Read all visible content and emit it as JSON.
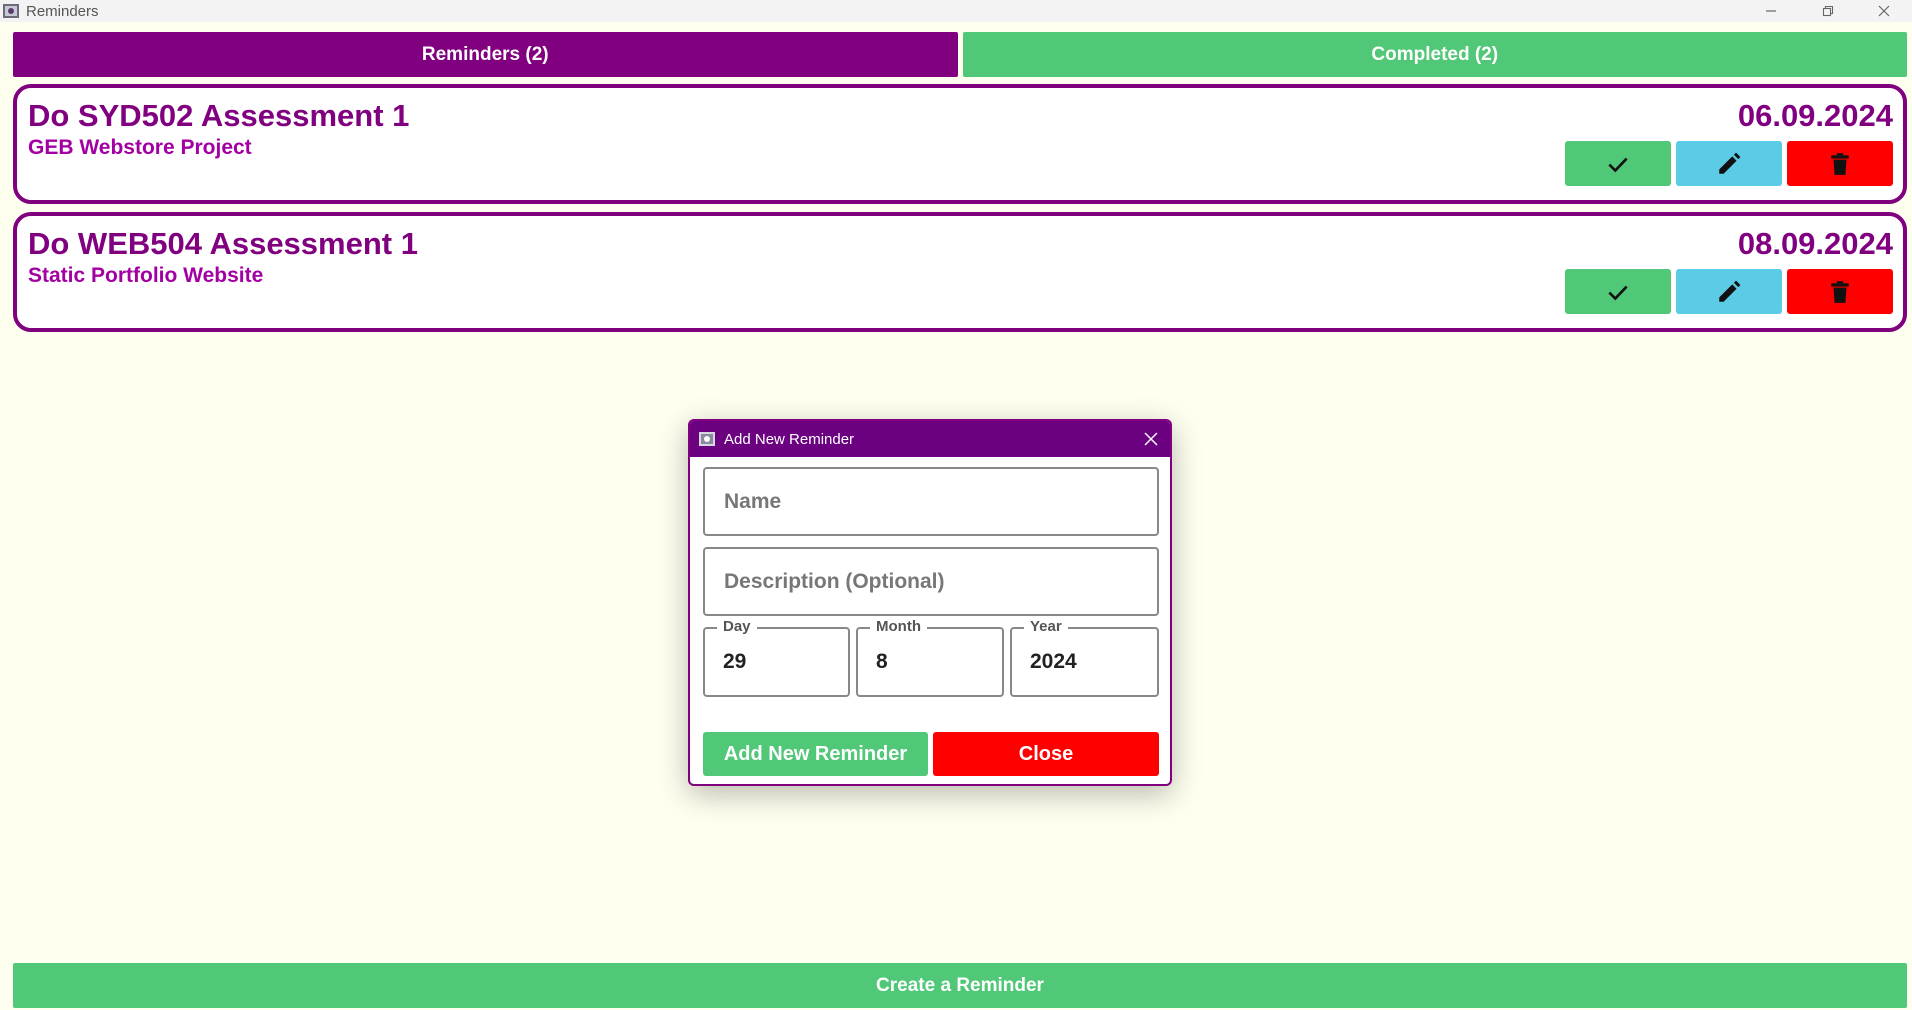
{
  "window": {
    "title": "Reminders",
    "icon": "app-icon",
    "controls": [
      "minimize-icon",
      "restore-icon",
      "close-icon"
    ]
  },
  "tabs": [
    {
      "label": "Reminders (2)",
      "active": true
    },
    {
      "label": "Completed (2)",
      "active": false
    }
  ],
  "reminders": [
    {
      "name": "Do SYD502 Assessment 1",
      "description": "GEB Webstore Project",
      "date": "06.09.2024"
    },
    {
      "name": "Do WEB504 Assessment 1",
      "description": "Static Portfolio Website",
      "date": "08.09.2024"
    }
  ],
  "reminder_actions": [
    "check-icon",
    "pencil-icon",
    "trash-icon"
  ],
  "create_button": "Create a Reminder",
  "dialog": {
    "title": "Add New Reminder",
    "name_placeholder": "Name",
    "description_placeholder": "Description (Optional)",
    "day_label": "Day",
    "day_value": "29",
    "month_label": "Month",
    "month_value": "8",
    "year_label": "Year",
    "year_value": "2024",
    "add_button": "Add New Reminder",
    "close_button": "Close"
  },
  "colors": {
    "purple": "#800080",
    "green": "#50c878",
    "blue": "#5bcbe6",
    "red": "#ff0000",
    "background": "#fffff0"
  }
}
